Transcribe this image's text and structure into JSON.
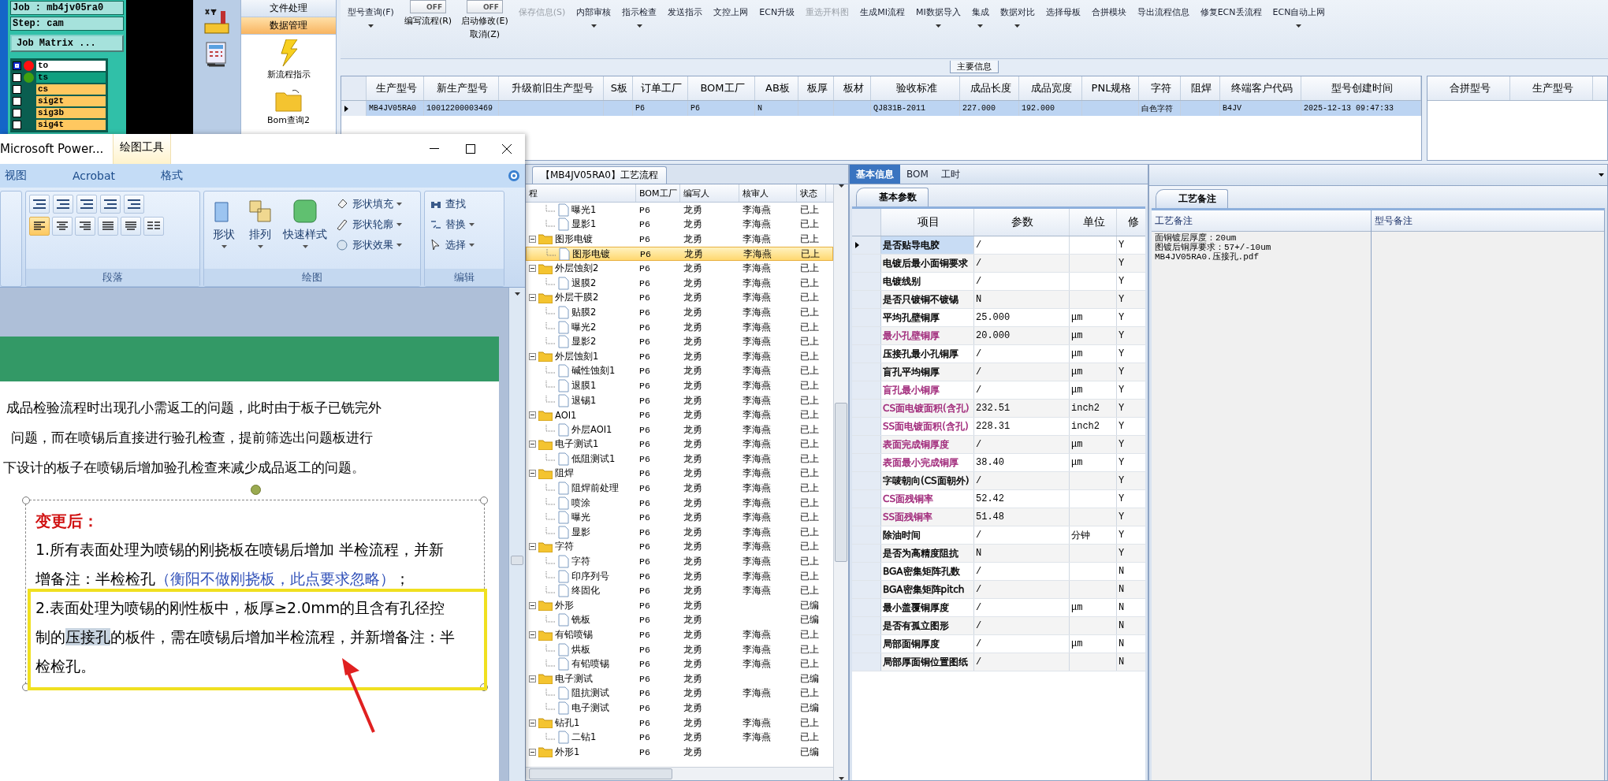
{
  "cam": {
    "job": "Job : mb4jv05ra0",
    "step": "Step: cam",
    "matrix_button": "Job Matrix ...",
    "layers": [
      {
        "name": "to",
        "selected": true,
        "color": "#ffffff",
        "status": {
          "color": "#ff1010"
        }
      },
      {
        "name": "ts",
        "selected": false,
        "color": "#10a080",
        "status": {
          "color": "#40a010"
        }
      },
      {
        "name": "cs",
        "selected": false,
        "color": "#ffc860"
      },
      {
        "name": "sig2t",
        "selected": false,
        "color": "#ffc860"
      },
      {
        "name": "sig3b",
        "selected": false,
        "color": "#ffc860"
      },
      {
        "name": "sig4t",
        "selected": false,
        "color": "#ffc860"
      }
    ]
  },
  "nav": {
    "sections": [
      {
        "label": "文件处理",
        "selected": false
      },
      {
        "label": "数据管理",
        "selected": true
      }
    ],
    "items": [
      {
        "label": "新流程指示",
        "kind": "lightning"
      },
      {
        "label": "Bom查询2",
        "kind": "folder"
      }
    ]
  },
  "toolbar": [
    {
      "kind": "button",
      "label": "型号查询(F)",
      "dropdown": true,
      "disabled": false
    },
    {
      "kind": "toggle",
      "label": "编写流程(R)",
      "state": "OFF",
      "on": false
    },
    {
      "kind": "toggle",
      "label": "启动修改(E)",
      "sub_label": "取消(Z)",
      "state": "OFF",
      "on": false
    },
    {
      "kind": "button",
      "label": "保存信息(S)",
      "dropdown": false,
      "disabled": true
    },
    {
      "kind": "button",
      "label": "内部审核",
      "dropdown": true,
      "disabled": false
    },
    {
      "kind": "button",
      "label": "指示检查",
      "dropdown": true,
      "disabled": false
    },
    {
      "kind": "button",
      "label": "发送指示",
      "dropdown": false,
      "disabled": false
    },
    {
      "kind": "button",
      "label": "文控上网",
      "dropdown": false,
      "disabled": false
    },
    {
      "kind": "button",
      "label": "ECN升级",
      "dropdown": false,
      "disabled": false
    },
    {
      "kind": "button",
      "label": "重选开料图",
      "dropdown": false,
      "disabled": true
    },
    {
      "kind": "button",
      "label": "生成MI流程",
      "dropdown": false,
      "disabled": false
    },
    {
      "kind": "button",
      "label": "MI数据导入",
      "dropdown": true,
      "disabled": false
    },
    {
      "kind": "button",
      "label": "集成",
      "dropdown": true,
      "disabled": false
    },
    {
      "kind": "button",
      "label": "数据对比",
      "dropdown": true,
      "disabled": false
    },
    {
      "kind": "button",
      "label": "选择母板",
      "dropdown": false,
      "disabled": false
    },
    {
      "kind": "button",
      "label": "合拼模块",
      "dropdown": false,
      "disabled": false
    },
    {
      "kind": "button",
      "label": "导出流程信息",
      "dropdown": false,
      "disabled": false
    },
    {
      "kind": "button",
      "label": "修复ECN丢流程",
      "dropdown": false,
      "disabled": false
    },
    {
      "kind": "button",
      "label": "ECN自动上网",
      "dropdown": true,
      "disabled": false
    }
  ],
  "main_info": {
    "title": "主要信息",
    "columns": [
      "生产型号",
      "新生产型号",
      "升级前旧生产型号",
      "S板",
      "订单工厂",
      "BOM工厂",
      "AB板",
      "板厚",
      "板材",
      "验收标准",
      "成品长度",
      "成品宽度",
      "PNL规格",
      "字符",
      "阻焊",
      "终端客户代码",
      "型号创建时间"
    ],
    "rows": [
      {
        "selected": true,
        "cells": [
          "MB4JV05RA0",
          "10012200003469",
          "",
          "",
          "P6",
          "P6",
          "N",
          "",
          "",
          "QJ831B-2011",
          "227.000",
          "192.000",
          "",
          "白色字符",
          "",
          "B4JV",
          "2025-12-13 09:47:33"
        ]
      }
    ],
    "side_columns": [
      "合拼型号",
      "生产型号"
    ]
  },
  "process": {
    "tab": "【MB4JV05RA0】工艺流程",
    "columns": [
      "程",
      "BOM工厂",
      "编写人",
      "核审人",
      "状态"
    ],
    "rows": [
      {
        "children": [
          {
            "label": "曝光1",
            "bom": "P6",
            "writer": "龙勇",
            "reviewer": "李海燕",
            "status": "已上",
            "selected": false
          },
          {
            "label": "显影1",
            "bom": "P6",
            "writer": "龙勇",
            "reviewer": "李海燕",
            "status": "已上",
            "selected": false
          }
        ]
      },
      {
        "label": "图形电镀",
        "bom": "P6",
        "writer": "龙勇",
        "reviewer": "李海燕",
        "status": "已上",
        "selected": false,
        "children": [
          {
            "label": "图形电镀",
            "bom": "P6",
            "writer": "龙勇",
            "reviewer": "李海燕",
            "status": "已上",
            "selected": true
          }
        ]
      },
      {
        "label": "外层蚀刻2",
        "bom": "P6",
        "writer": "龙勇",
        "reviewer": "李海燕",
        "status": "已上",
        "selected": false,
        "children": [
          {
            "label": "退膜2",
            "bom": "P6",
            "writer": "龙勇",
            "reviewer": "李海燕",
            "status": "已上",
            "selected": false
          }
        ]
      },
      {
        "label": "外层干膜2",
        "bom": "P6",
        "writer": "龙勇",
        "reviewer": "李海燕",
        "status": "已上",
        "selected": false,
        "children": [
          {
            "label": "贴膜2",
            "bom": "P6",
            "writer": "龙勇",
            "reviewer": "李海燕",
            "status": "已上",
            "selected": false
          },
          {
            "label": "曝光2",
            "bom": "P6",
            "writer": "龙勇",
            "reviewer": "李海燕",
            "status": "已上",
            "selected": false
          },
          {
            "label": "显影2",
            "bom": "P6",
            "writer": "龙勇",
            "reviewer": "李海燕",
            "status": "已上",
            "selected": false
          }
        ]
      },
      {
        "label": "外层蚀刻1",
        "bom": "P6",
        "writer": "龙勇",
        "reviewer": "李海燕",
        "status": "已上",
        "selected": false,
        "children": [
          {
            "label": "碱性蚀刻1",
            "bom": "P6",
            "writer": "龙勇",
            "reviewer": "李海燕",
            "status": "已上",
            "selected": false
          },
          {
            "label": "退膜1",
            "bom": "P6",
            "writer": "龙勇",
            "reviewer": "李海燕",
            "status": "已上",
            "selected": false
          },
          {
            "label": "退锡1",
            "bom": "P6",
            "writer": "龙勇",
            "reviewer": "李海燕",
            "status": "已上",
            "selected": false
          }
        ]
      },
      {
        "label": "AOI1",
        "bom": "P6",
        "writer": "龙勇",
        "reviewer": "李海燕",
        "status": "已上",
        "selected": false,
        "children": [
          {
            "label": "外层AOI1",
            "bom": "P6",
            "writer": "龙勇",
            "reviewer": "李海燕",
            "status": "已上",
            "selected": false
          }
        ]
      },
      {
        "label": "电子测试1",
        "bom": "P6",
        "writer": "龙勇",
        "reviewer": "李海燕",
        "status": "已上",
        "selected": false,
        "children": [
          {
            "label": "低阻测试1",
            "bom": "P6",
            "writer": "龙勇",
            "reviewer": "李海燕",
            "status": "已上",
            "selected": false
          }
        ]
      },
      {
        "label": "阻焊",
        "bom": "P6",
        "writer": "龙勇",
        "reviewer": "李海燕",
        "status": "已上",
        "selected": false,
        "children": [
          {
            "label": "阻焊前处理",
            "bom": "P6",
            "writer": "龙勇",
            "reviewer": "李海燕",
            "status": "已上",
            "selected": false
          },
          {
            "label": "喷涂",
            "bom": "P6",
            "writer": "龙勇",
            "reviewer": "李海燕",
            "status": "已上",
            "selected": false
          },
          {
            "label": "曝光",
            "bom": "P6",
            "writer": "龙勇",
            "reviewer": "李海燕",
            "status": "已上",
            "selected": false
          },
          {
            "label": "显影",
            "bom": "P6",
            "writer": "龙勇",
            "reviewer": "李海燕",
            "status": "已上",
            "selected": false
          }
        ]
      },
      {
        "label": "字符",
        "bom": "P6",
        "writer": "龙勇",
        "reviewer": "李海燕",
        "status": "已上",
        "selected": false,
        "children": [
          {
            "label": "字符",
            "bom": "P6",
            "writer": "龙勇",
            "reviewer": "李海燕",
            "status": "已上",
            "selected": false
          },
          {
            "label": "印序列号",
            "bom": "P6",
            "writer": "龙勇",
            "reviewer": "李海燕",
            "status": "已上",
            "selected": false
          },
          {
            "label": "终固化",
            "bom": "P6",
            "writer": "龙勇",
            "reviewer": "李海燕",
            "status": "已上",
            "selected": false
          }
        ]
      },
      {
        "label": "外形",
        "bom": "P6",
        "writer": "龙勇",
        "status": "已编",
        "selected": false,
        "children": [
          {
            "label": "铣板",
            "bom": "P6",
            "writer": "龙勇",
            "status": "已编",
            "selected": false
          }
        ]
      },
      {
        "label": "有铅喷锡",
        "bom": "P6",
        "writer": "龙勇",
        "reviewer": "李海燕",
        "status": "已上",
        "selected": false,
        "children": [
          {
            "label": "烘板",
            "bom": "P6",
            "writer": "龙勇",
            "reviewer": "李海燕",
            "status": "已上",
            "selected": false
          },
          {
            "label": "有铅喷锡",
            "bom": "P6",
            "writer": "龙勇",
            "reviewer": "李海燕",
            "status": "已上",
            "selected": false
          }
        ]
      },
      {
        "label": "电子测试",
        "bom": "P6",
        "writer": "龙勇",
        "status": "已编",
        "selected": false,
        "children": [
          {
            "label": "阻抗测试",
            "bom": "P6",
            "writer": "龙勇",
            "reviewer": "李海燕",
            "status": "已上",
            "selected": false
          },
          {
            "label": "电子测试",
            "bom": "P6",
            "writer": "龙勇",
            "status": "已编",
            "selected": false
          }
        ]
      },
      {
        "label": "钻孔1",
        "bom": "P6",
        "writer": "龙勇",
        "reviewer": "李海燕",
        "status": "已上",
        "selected": false,
        "children": [
          {
            "label": "二钻1",
            "bom": "P6",
            "writer": "龙勇",
            "reviewer": "李海燕",
            "status": "已上",
            "selected": false
          }
        ]
      },
      {
        "label": "外形1",
        "bom": "P6",
        "writer": "龙勇",
        "status": "已编",
        "selected": false,
        "children": []
      }
    ]
  },
  "basic": {
    "tabs": [
      {
        "label": "基本信息",
        "selected": true
      },
      {
        "label": "BOM",
        "selected": false
      },
      {
        "label": "工时",
        "selected": false
      }
    ],
    "sub_tab": "基本参数",
    "columns": [
      "项目",
      "参数",
      "单位",
      "修"
    ],
    "rows": [
      {
        "item": "是否贴导电胶",
        "value": "/",
        "unit": "",
        "modify": "Y",
        "color": "#000000",
        "selected": true
      },
      {
        "item": "电镀后最小面铜要求",
        "value": "/",
        "unit": "",
        "modify": "Y",
        "color": "#000000",
        "selected": false
      },
      {
        "item": "电镀线别",
        "value": "/",
        "unit": "",
        "modify": "Y",
        "color": "#000000",
        "selected": false
      },
      {
        "item": "是否只镀铜不镀锡",
        "value": "N",
        "unit": "",
        "modify": "Y",
        "color": "#000000",
        "selected": false
      },
      {
        "item": "平均孔壁铜厚",
        "value": "25.000",
        "unit": "μm",
        "modify": "Y",
        "color": "#000000",
        "selected": false
      },
      {
        "item": "最小孔壁铜厚",
        "value": "20.000",
        "unit": "μm",
        "modify": "Y",
        "color": "#a0287a",
        "selected": false
      },
      {
        "item": "压接孔最小孔铜厚",
        "value": "/",
        "unit": "μm",
        "modify": "Y",
        "color": "#000000",
        "selected": false
      },
      {
        "item": "盲孔平均铜厚",
        "value": "/",
        "unit": "μm",
        "modify": "Y",
        "color": "#000000",
        "selected": false
      },
      {
        "item": "盲孔最小铜厚",
        "value": "/",
        "unit": "μm",
        "modify": "Y",
        "color": "#a0287a",
        "selected": false
      },
      {
        "item": "CS面电镀面积(含孔)",
        "value": "232.51",
        "unit": "inch2",
        "modify": "Y",
        "color": "#a0287a",
        "selected": false
      },
      {
        "item": "SS面电镀面积(含孔)",
        "value": "228.31",
        "unit": "inch2",
        "modify": "Y",
        "color": "#a0287a",
        "selected": false
      },
      {
        "item": "表面完成铜厚度",
        "value": "/",
        "unit": "μm",
        "modify": "Y",
        "color": "#a0287a",
        "selected": false
      },
      {
        "item": "表面最小完成铜厚",
        "value": "38.40",
        "unit": "μm",
        "modify": "Y",
        "color": "#a0287a",
        "selected": false
      },
      {
        "item": "字唛朝向(CS面朝外)",
        "value": "/",
        "unit": "",
        "modify": "Y",
        "color": "#000000",
        "selected": false
      },
      {
        "item": "CS面残铜率",
        "value": "52.42",
        "unit": "",
        "modify": "Y",
        "color": "#a0287a",
        "selected": false
      },
      {
        "item": "SS面残铜率",
        "value": "51.48",
        "unit": "",
        "modify": "Y",
        "color": "#a0287a",
        "selected": false
      },
      {
        "item": "除油时间",
        "value": "/",
        "unit": "分钟",
        "modify": "Y",
        "color": "#000000",
        "selected": false
      },
      {
        "item": "是否为高精度阻抗",
        "value": "N",
        "unit": "",
        "modify": "Y",
        "color": "#000000",
        "selected": false
      },
      {
        "item": "BGA密集矩阵孔数",
        "value": "/",
        "unit": "",
        "modify": "N",
        "color": "#000000",
        "selected": false
      },
      {
        "item": "BGA密集矩阵pitch",
        "value": "/",
        "unit": "",
        "modify": "N",
        "color": "#000000",
        "selected": false
      },
      {
        "item": "最小盖覆铜厚度",
        "value": "/",
        "unit": "μm",
        "modify": "N",
        "color": "#000000",
        "selected": false
      },
      {
        "item": "是否有孤立图形",
        "value": "/",
        "unit": "",
        "modify": "N",
        "color": "#000000",
        "selected": false
      },
      {
        "item": "局部面铜厚度",
        "value": "/",
        "unit": "μm",
        "modify": "N",
        "color": "#000000",
        "selected": false
      },
      {
        "item": "局部厚面铜位置图纸",
        "value": "/",
        "unit": "",
        "modify": "N",
        "color": "#000000",
        "selected": false
      }
    ]
  },
  "notes": {
    "tab": "工艺备注",
    "columns": [
      "工艺备注",
      "型号备注"
    ],
    "process_notes": [
      "面铜镀层厚度：20um",
      "图镀后铜厚要求：57+/-10um",
      "MB4JV05RA0.压接孔.pdf"
    ]
  },
  "ppt": {
    "title": "Microsoft Power...",
    "context_tab": "绘图工具",
    "tabs": [
      {
        "label": "视图",
        "selected": false,
        "contextual": false
      },
      {
        "label": "Acrobat",
        "selected": false,
        "contextual": false
      },
      {
        "label": "格式",
        "selected": false,
        "contextual": true
      }
    ],
    "paragraph_group": {
      "label": "段落",
      "align_buttons": [
        {
          "selected": true
        },
        {
          "selected": false
        },
        {
          "selected": false
        },
        {
          "selected": false
        },
        {
          "selected": false
        }
      ]
    },
    "drawing_group": {
      "label": "绘图",
      "large_buttons": [
        "形状",
        "排列",
        "快速样式"
      ],
      "small_buttons": [
        "形状填充",
        "形状轮廓",
        "形状效果"
      ]
    },
    "editing_group": {
      "label": "编辑",
      "buttons": [
        {
          "label": "查找",
          "dropdown": false
        },
        {
          "label": "替换",
          "dropdown": true
        },
        {
          "label": "选择",
          "dropdown": true
        }
      ]
    },
    "slide": {
      "body_lines": [
        "成品检验流程时出现孔小需返工的问题，此时由于板子已铣完外",
        "问题，而在喷锡后直接进行验孔检查，提前筛选出问题板进行",
        "下设计的板子在喷锡后增加验孔检查来减少成品返工的问题。"
      ],
      "textbox": {
        "heading": "变更后：",
        "item_1": {
          "text": "1.所有表面处理为喷锡的刚挠板在喷锡后增加 半检流程，并新增备注：半检检孔",
          "note": "（衡阳不做刚挠板，此点要求忽略）",
          "end": "；"
        },
        "item_2": {
          "before": "2.表面处理为喷锡的刚性板中，板厚≥2.0mm的且含有孔径控制的",
          "highlight": "压接孔",
          "after": "的板件，需在喷锡后增加半检流程，并新增备注：半检检孔。"
        }
      }
    }
  }
}
